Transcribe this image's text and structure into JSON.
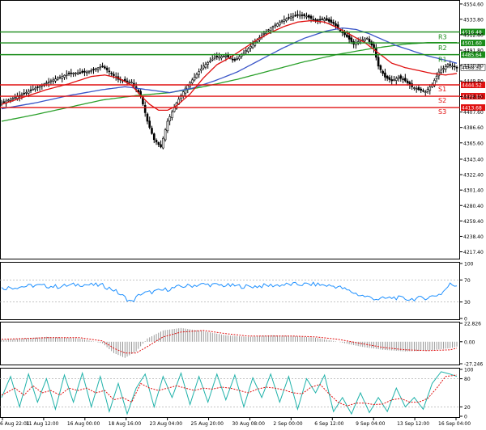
{
  "chart_data": {
    "type": "candlestick",
    "price_axis": {
      "ylim": [
        4207,
        4560
      ],
      "ticks": [
        4554.6,
        4533.8,
        4512.8,
        4491.8,
        4470.8,
        4449.8,
        4428.6,
        4407.6,
        4386.6,
        4365.6,
        4343.4,
        4322.4,
        4301.4,
        4280.4,
        4259.4,
        4238.4,
        4217.4
      ],
      "tick_labels": [
        "4554.60",
        "4533.80",
        "4512.80",
        "4491.80",
        "4470.80",
        "4449.80",
        "4428.60",
        "4407.60",
        "4386.60",
        "4365.60",
        "4343.40",
        "4322.40",
        "4301.40",
        "4280.40",
        "4259.40",
        "4238.40",
        "4217.40"
      ]
    },
    "time_axis": {
      "labels": [
        "6 Aug 22:01",
        "11 Aug 12:00",
        "16 Aug 00:00",
        "18 Aug 16:00",
        "23 Aug 04:00",
        "25 Aug 20:00",
        "30 Aug 08:00",
        "2 Sep 00:00",
        "6 Sep 12:00",
        "9 Sep 04:00",
        "13 Sep 12:00",
        "16 Sep 04:00"
      ]
    },
    "levels": [
      {
        "name": "R3",
        "value": 4516.48,
        "label": "4516.48",
        "color": "#1a8c1a"
      },
      {
        "name": "R2",
        "value": 4501.6,
        "label": "4501.60",
        "color": "#1a8c1a"
      },
      {
        "name": "R1",
        "value": 4485.64,
        "label": "4485.64",
        "color": "#1a8c1a"
      },
      {
        "name": "S1",
        "value": 4444.52,
        "label": "4444.52",
        "color": "#e01010"
      },
      {
        "name": "S2",
        "value": 4429.1,
        "label": "4429.10",
        "color": "#e01010"
      },
      {
        "name": "S3",
        "value": 4413.68,
        "label": "4413.68",
        "color": "#e01010"
      }
    ],
    "current_price": {
      "value": 4468.32,
      "label": "4468.32"
    },
    "price_keypoints": [
      [
        0,
        4420
      ],
      [
        8,
        4430
      ],
      [
        15,
        4440
      ],
      [
        22,
        4450
      ],
      [
        30,
        4460
      ],
      [
        38,
        4462
      ],
      [
        45,
        4470
      ],
      [
        52,
        4452
      ],
      [
        58,
        4448
      ],
      [
        62,
        4430
      ],
      [
        65,
        4395
      ],
      [
        68,
        4370
      ],
      [
        71,
        4360
      ],
      [
        74,
        4395
      ],
      [
        78,
        4420
      ],
      [
        82,
        4440
      ],
      [
        86,
        4455
      ],
      [
        90,
        4470
      ],
      [
        95,
        4482
      ],
      [
        100,
        4484
      ],
      [
        104,
        4478
      ],
      [
        108,
        4488
      ],
      [
        112,
        4500
      ],
      [
        116,
        4512
      ],
      [
        120,
        4522
      ],
      [
        124,
        4530
      ],
      [
        128,
        4536
      ],
      [
        132,
        4540
      ],
      [
        136,
        4538
      ],
      [
        140,
        4532
      ],
      [
        144,
        4534
      ],
      [
        148,
        4528
      ],
      [
        151,
        4518
      ],
      [
        154,
        4510
      ],
      [
        157,
        4500
      ],
      [
        160,
        4505
      ],
      [
        163,
        4508
      ],
      [
        166,
        4494
      ],
      [
        168,
        4470
      ],
      [
        171,
        4455
      ],
      [
        174,
        4450
      ],
      [
        177,
        4455
      ],
      [
        180,
        4450
      ],
      [
        183,
        4442
      ],
      [
        186,
        4438
      ],
      [
        189,
        4435
      ],
      [
        192,
        4445
      ],
      [
        195,
        4462
      ],
      [
        199,
        4472
      ],
      [
        203,
        4468
      ]
    ],
    "ma_red_keypoints": [
      [
        0,
        4418
      ],
      [
        10,
        4428
      ],
      [
        20,
        4438
      ],
      [
        30,
        4446
      ],
      [
        40,
        4456
      ],
      [
        46,
        4458
      ],
      [
        52,
        4454
      ],
      [
        58,
        4444
      ],
      [
        62,
        4430
      ],
      [
        66,
        4418
      ],
      [
        70,
        4410
      ],
      [
        74,
        4410
      ],
      [
        78,
        4416
      ],
      [
        84,
        4432
      ],
      [
        90,
        4454
      ],
      [
        96,
        4472
      ],
      [
        102,
        4482
      ],
      [
        108,
        4494
      ],
      [
        114,
        4506
      ],
      [
        120,
        4516
      ],
      [
        126,
        4524
      ],
      [
        132,
        4530
      ],
      [
        138,
        4532
      ],
      [
        144,
        4530
      ],
      [
        150,
        4522
      ],
      [
        156,
        4512
      ],
      [
        162,
        4502
      ],
      [
        168,
        4488
      ],
      [
        174,
        4474
      ],
      [
        180,
        4468
      ],
      [
        186,
        4464
      ],
      [
        192,
        4460
      ],
      [
        198,
        4458
      ],
      [
        203,
        4460
      ]
    ],
    "ma_blue_keypoints": [
      [
        0,
        4412
      ],
      [
        15,
        4420
      ],
      [
        30,
        4430
      ],
      [
        45,
        4438
      ],
      [
        55,
        4442
      ],
      [
        65,
        4438
      ],
      [
        75,
        4434
      ],
      [
        85,
        4440
      ],
      [
        95,
        4450
      ],
      [
        105,
        4462
      ],
      [
        115,
        4478
      ],
      [
        125,
        4494
      ],
      [
        135,
        4508
      ],
      [
        145,
        4518
      ],
      [
        152,
        4522
      ],
      [
        158,
        4520
      ],
      [
        164,
        4514
      ],
      [
        170,
        4506
      ],
      [
        176,
        4498
      ],
      [
        182,
        4492
      ],
      [
        190,
        4484
      ],
      [
        198,
        4478
      ],
      [
        203,
        4474
      ]
    ],
    "ma_green_keypoints": [
      [
        0,
        4395
      ],
      [
        15,
        4404
      ],
      [
        30,
        4414
      ],
      [
        45,
        4424
      ],
      [
        60,
        4430
      ],
      [
        75,
        4434
      ],
      [
        90,
        4442
      ],
      [
        105,
        4452
      ],
      [
        120,
        4464
      ],
      [
        135,
        4476
      ],
      [
        150,
        4486
      ],
      [
        165,
        4494
      ],
      [
        180,
        4500
      ],
      [
        190,
        4502
      ],
      [
        203,
        4502
      ]
    ],
    "indicators": [
      {
        "name": "rsi",
        "ylim": [
          0,
          100
        ],
        "tick_labels": [
          "100",
          "70",
          "30",
          "0"
        ],
        "levels": [
          70,
          30
        ],
        "keypoints": [
          [
            0,
            55
          ],
          [
            15,
            60
          ],
          [
            25,
            58
          ],
          [
            35,
            62
          ],
          [
            45,
            60
          ],
          [
            50,
            52
          ],
          [
            55,
            38
          ],
          [
            58,
            30
          ],
          [
            62,
            45
          ],
          [
            70,
            50
          ],
          [
            80,
            58
          ],
          [
            90,
            62
          ],
          [
            100,
            60
          ],
          [
            110,
            58
          ],
          [
            120,
            60
          ],
          [
            130,
            62
          ],
          [
            140,
            62
          ],
          [
            150,
            58
          ],
          [
            155,
            50
          ],
          [
            160,
            42
          ],
          [
            168,
            35
          ],
          [
            175,
            38
          ],
          [
            182,
            35
          ],
          [
            190,
            38
          ],
          [
            196,
            45
          ],
          [
            200,
            62
          ],
          [
            203,
            60
          ]
        ]
      },
      {
        "name": "macd",
        "ylim": [
          -27.246,
          22.826
        ],
        "tick_labels": [
          "22.826",
          "0.00",
          "-27.246"
        ],
        "hist_keypoints": [
          [
            0,
            2
          ],
          [
            20,
            6
          ],
          [
            35,
            4
          ],
          [
            45,
            -2
          ],
          [
            50,
            -14
          ],
          [
            55,
            -20
          ],
          [
            60,
            -12
          ],
          [
            65,
            4
          ],
          [
            72,
            14
          ],
          [
            80,
            17
          ],
          [
            90,
            13
          ],
          [
            100,
            8
          ],
          [
            110,
            6
          ],
          [
            120,
            8
          ],
          [
            130,
            7
          ],
          [
            140,
            5
          ],
          [
            150,
            0
          ],
          [
            160,
            -6
          ],
          [
            170,
            -10
          ],
          [
            180,
            -12
          ],
          [
            190,
            -11
          ],
          [
            200,
            -8
          ],
          [
            203,
            -6
          ]
        ],
        "signal_keypoints": [
          [
            0,
            3
          ],
          [
            20,
            5
          ],
          [
            35,
            5
          ],
          [
            45,
            1
          ],
          [
            50,
            -8
          ],
          [
            55,
            -14
          ],
          [
            60,
            -14
          ],
          [
            65,
            -6
          ],
          [
            72,
            6
          ],
          [
            80,
            12
          ],
          [
            90,
            14
          ],
          [
            100,
            10
          ],
          [
            110,
            7
          ],
          [
            120,
            7
          ],
          [
            130,
            7
          ],
          [
            140,
            6
          ],
          [
            150,
            3
          ],
          [
            160,
            -2
          ],
          [
            170,
            -7
          ],
          [
            180,
            -10
          ],
          [
            190,
            -11
          ],
          [
            200,
            -10
          ],
          [
            203,
            -8
          ]
        ]
      },
      {
        "name": "stochastic",
        "ylim": [
          0,
          100
        ],
        "tick_labels": [
          "100",
          "80",
          "20",
          "0"
        ],
        "levels": [
          80,
          20
        ],
        "k_keypoints": [
          [
            0,
            40
          ],
          [
            4,
            85
          ],
          [
            8,
            20
          ],
          [
            12,
            90
          ],
          [
            16,
            30
          ],
          [
            20,
            80
          ],
          [
            24,
            15
          ],
          [
            28,
            88
          ],
          [
            32,
            30
          ],
          [
            36,
            92
          ],
          [
            40,
            20
          ],
          [
            44,
            85
          ],
          [
            48,
            10
          ],
          [
            52,
            70
          ],
          [
            56,
            5
          ],
          [
            60,
            60
          ],
          [
            64,
            90
          ],
          [
            68,
            20
          ],
          [
            72,
            85
          ],
          [
            76,
            40
          ],
          [
            80,
            92
          ],
          [
            84,
            25
          ],
          [
            88,
            85
          ],
          [
            92,
            30
          ],
          [
            96,
            90
          ],
          [
            100,
            35
          ],
          [
            104,
            88
          ],
          [
            108,
            20
          ],
          [
            112,
            82
          ],
          [
            116,
            40
          ],
          [
            120,
            90
          ],
          [
            124,
            30
          ],
          [
            128,
            85
          ],
          [
            132,
            15
          ],
          [
            136,
            80
          ],
          [
            140,
            50
          ],
          [
            144,
            88
          ],
          [
            148,
            10
          ],
          [
            152,
            40
          ],
          [
            156,
            5
          ],
          [
            160,
            50
          ],
          [
            164,
            8
          ],
          [
            168,
            40
          ],
          [
            172,
            10
          ],
          [
            176,
            60
          ],
          [
            180,
            20
          ],
          [
            184,
            40
          ],
          [
            188,
            15
          ],
          [
            192,
            70
          ],
          [
            196,
            95
          ],
          [
            200,
            90
          ],
          [
            203,
            85
          ]
        ],
        "d_keypoints": [
          [
            0,
            45
          ],
          [
            6,
            60
          ],
          [
            10,
            45
          ],
          [
            14,
            65
          ],
          [
            18,
            50
          ],
          [
            22,
            55
          ],
          [
            26,
            45
          ],
          [
            30,
            60
          ],
          [
            34,
            55
          ],
          [
            38,
            60
          ],
          [
            42,
            50
          ],
          [
            46,
            55
          ],
          [
            50,
            35
          ],
          [
            54,
            40
          ],
          [
            58,
            30
          ],
          [
            62,
            70
          ],
          [
            66,
            60
          ],
          [
            70,
            55
          ],
          [
            74,
            60
          ],
          [
            78,
            65
          ],
          [
            82,
            60
          ],
          [
            86,
            55
          ],
          [
            90,
            60
          ],
          [
            94,
            58
          ],
          [
            98,
            62
          ],
          [
            102,
            60
          ],
          [
            106,
            55
          ],
          [
            110,
            50
          ],
          [
            114,
            58
          ],
          [
            118,
            62
          ],
          [
            122,
            60
          ],
          [
            126,
            56
          ],
          [
            130,
            50
          ],
          [
            134,
            48
          ],
          [
            138,
            62
          ],
          [
            142,
            68
          ],
          [
            146,
            48
          ],
          [
            150,
            30
          ],
          [
            154,
            22
          ],
          [
            158,
            28
          ],
          [
            162,
            28
          ],
          [
            166,
            25
          ],
          [
            170,
            26
          ],
          [
            174,
            35
          ],
          [
            178,
            38
          ],
          [
            182,
            30
          ],
          [
            186,
            30
          ],
          [
            190,
            38
          ],
          [
            194,
            60
          ],
          [
            198,
            85
          ],
          [
            203,
            88
          ]
        ]
      }
    ]
  }
}
